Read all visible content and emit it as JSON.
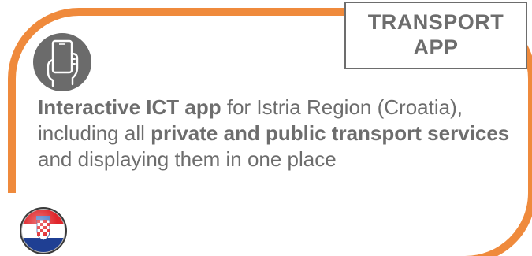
{
  "badge": {
    "line1": "TRANSPORT",
    "line2": "APP"
  },
  "description": {
    "part1": "Interactive ICT app",
    "part2": " for Istria Region (Croatia), including all ",
    "part3": "private and public transport services",
    "part4": " and displaying them in one place"
  },
  "icons": {
    "phone": "phone-hand-icon",
    "flag": "croatia-flag-icon"
  },
  "colors": {
    "frame": "#ef8a3c",
    "text": "#6d6d6d",
    "icon_bg": "#6b6b6b"
  }
}
